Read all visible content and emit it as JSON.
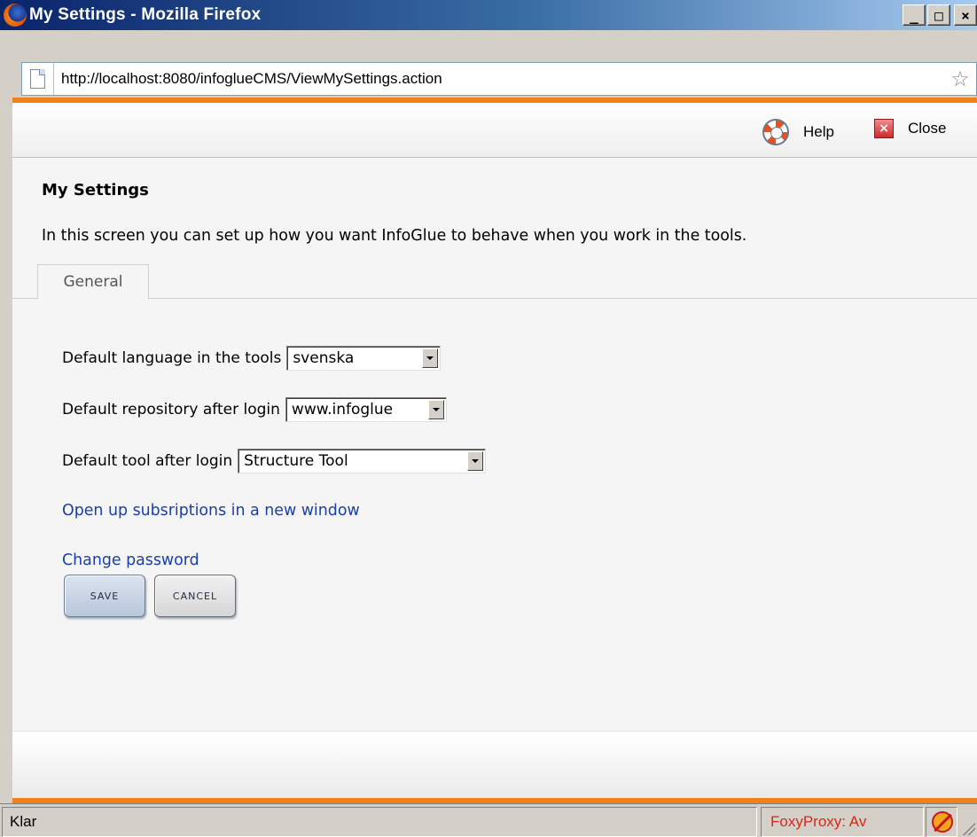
{
  "window": {
    "title": "My Settings - Mozilla Firefox",
    "buttons": {
      "minimize": "_",
      "maximize": "□",
      "close": "×"
    }
  },
  "addressbar": {
    "url": "http://localhost:8080/infoglueCMS/ViewMySettings.action",
    "page_icon": "page-icon",
    "bookmark_icon": "star-icon"
  },
  "toolbar": {
    "help_label": "Help",
    "close_label": "Close",
    "help_icon": "lifebuoy-icon",
    "close_icon": "close-icon"
  },
  "page": {
    "title": "My Settings",
    "intro": "In this screen you can set up how you want InfoGlue to behave when you work in the tools.",
    "tabs": [
      {
        "label": "General",
        "active": true
      }
    ]
  },
  "form": {
    "language": {
      "label": "Default language in the tools",
      "value": "svenska"
    },
    "repository": {
      "label": "Default repository after login",
      "value": "www.infoglue"
    },
    "tool": {
      "label": "Default tool after login",
      "value": "Structure Tool"
    }
  },
  "links": {
    "subscriptions": "Open up subsriptions in a new window",
    "change_password": "Change password"
  },
  "buttons": {
    "save": "SAVE",
    "cancel": "CANCEL"
  },
  "statusbar": {
    "status": "Klar",
    "foxyproxy": "FoxyProxy: Av"
  },
  "colors": {
    "accent_orange": "#f0821e",
    "link_blue": "#1a3fa8",
    "title_bar": "#0a246a",
    "foxyproxy_red": "#d8261b"
  }
}
